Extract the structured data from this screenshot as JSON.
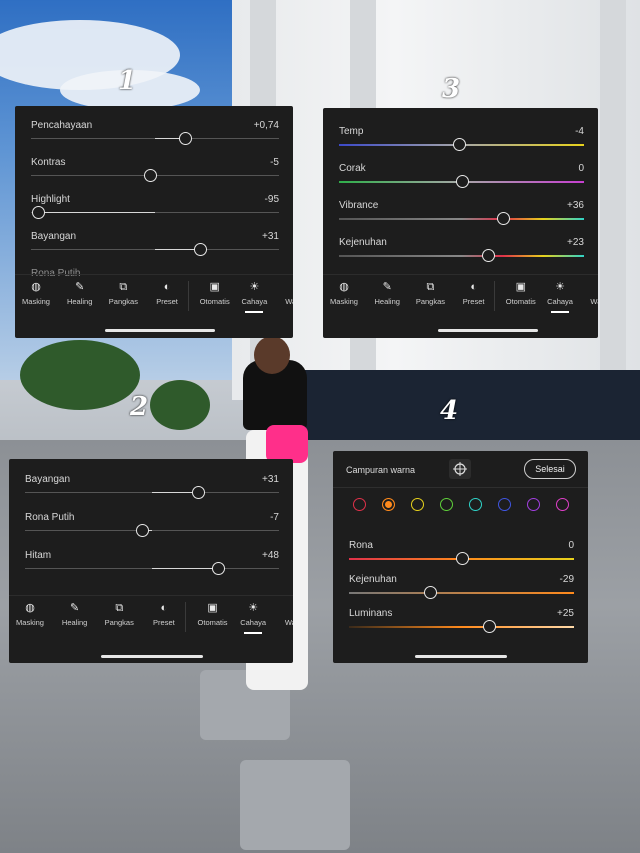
{
  "step_numbers": [
    "1",
    "2",
    "3",
    "4"
  ],
  "panel1": {
    "sliders": [
      {
        "label": "Pencahayaan",
        "value": "+0,74",
        "pos": 0.62
      },
      {
        "label": "Kontras",
        "value": "-5",
        "pos": 0.48
      },
      {
        "label": "Highlight",
        "value": "-95",
        "pos": 0.03
      },
      {
        "label": "Bayangan",
        "value": "+31",
        "pos": 0.68
      }
    ],
    "partial_label": "Rona Putih"
  },
  "panel2": {
    "sliders": [
      {
        "label": "Bayangan",
        "value": "+31",
        "pos": 0.68
      },
      {
        "label": "Rona Putih",
        "value": "-7",
        "pos": 0.46
      },
      {
        "label": "Hitam",
        "value": "+48",
        "pos": 0.76
      }
    ]
  },
  "panel3": {
    "sliders": [
      {
        "label": "Temp",
        "value": "-4",
        "pos": 0.49
      },
      {
        "label": "Corak",
        "value": "0",
        "pos": 0.5
      },
      {
        "label": "Vibrance",
        "value": "+36",
        "pos": 0.67
      },
      {
        "label": "Kejenuhan",
        "value": "+23",
        "pos": 0.61
      }
    ]
  },
  "panel4": {
    "title": "Campuran warna",
    "done_label": "Selesai",
    "colors": [
      "#e0314a",
      "#ff8a1c",
      "#e7d21c",
      "#5fcf3a",
      "#2fd3c8",
      "#3f55e0",
      "#a23fe0",
      "#e03fc9"
    ],
    "selected_color": 1,
    "sliders": [
      {
        "label": "Rona",
        "value": "0",
        "pos": 0.5
      },
      {
        "label": "Kejenuhan",
        "value": "-29",
        "pos": 0.36
      },
      {
        "label": "Luminans",
        "value": "+25",
        "pos": 0.62
      }
    ]
  },
  "toolbar": {
    "items": [
      {
        "label": "Masking",
        "icon": "masking-icon",
        "glyph": "◍"
      },
      {
        "label": "Healing",
        "icon": "healing-icon",
        "glyph": "✎"
      },
      {
        "label": "Pangkas",
        "icon": "crop-icon",
        "glyph": "⧉"
      },
      {
        "label": "Preset",
        "icon": "preset-icon",
        "glyph": "◐"
      },
      {
        "label": "Otomatis",
        "icon": "auto-icon",
        "glyph": "▣"
      },
      {
        "label": "Cahaya",
        "icon": "light-icon",
        "glyph": "☀"
      },
      {
        "label": "Warna",
        "icon": "color-icon",
        "glyph": "🌡"
      }
    ],
    "active": "Cahaya"
  }
}
